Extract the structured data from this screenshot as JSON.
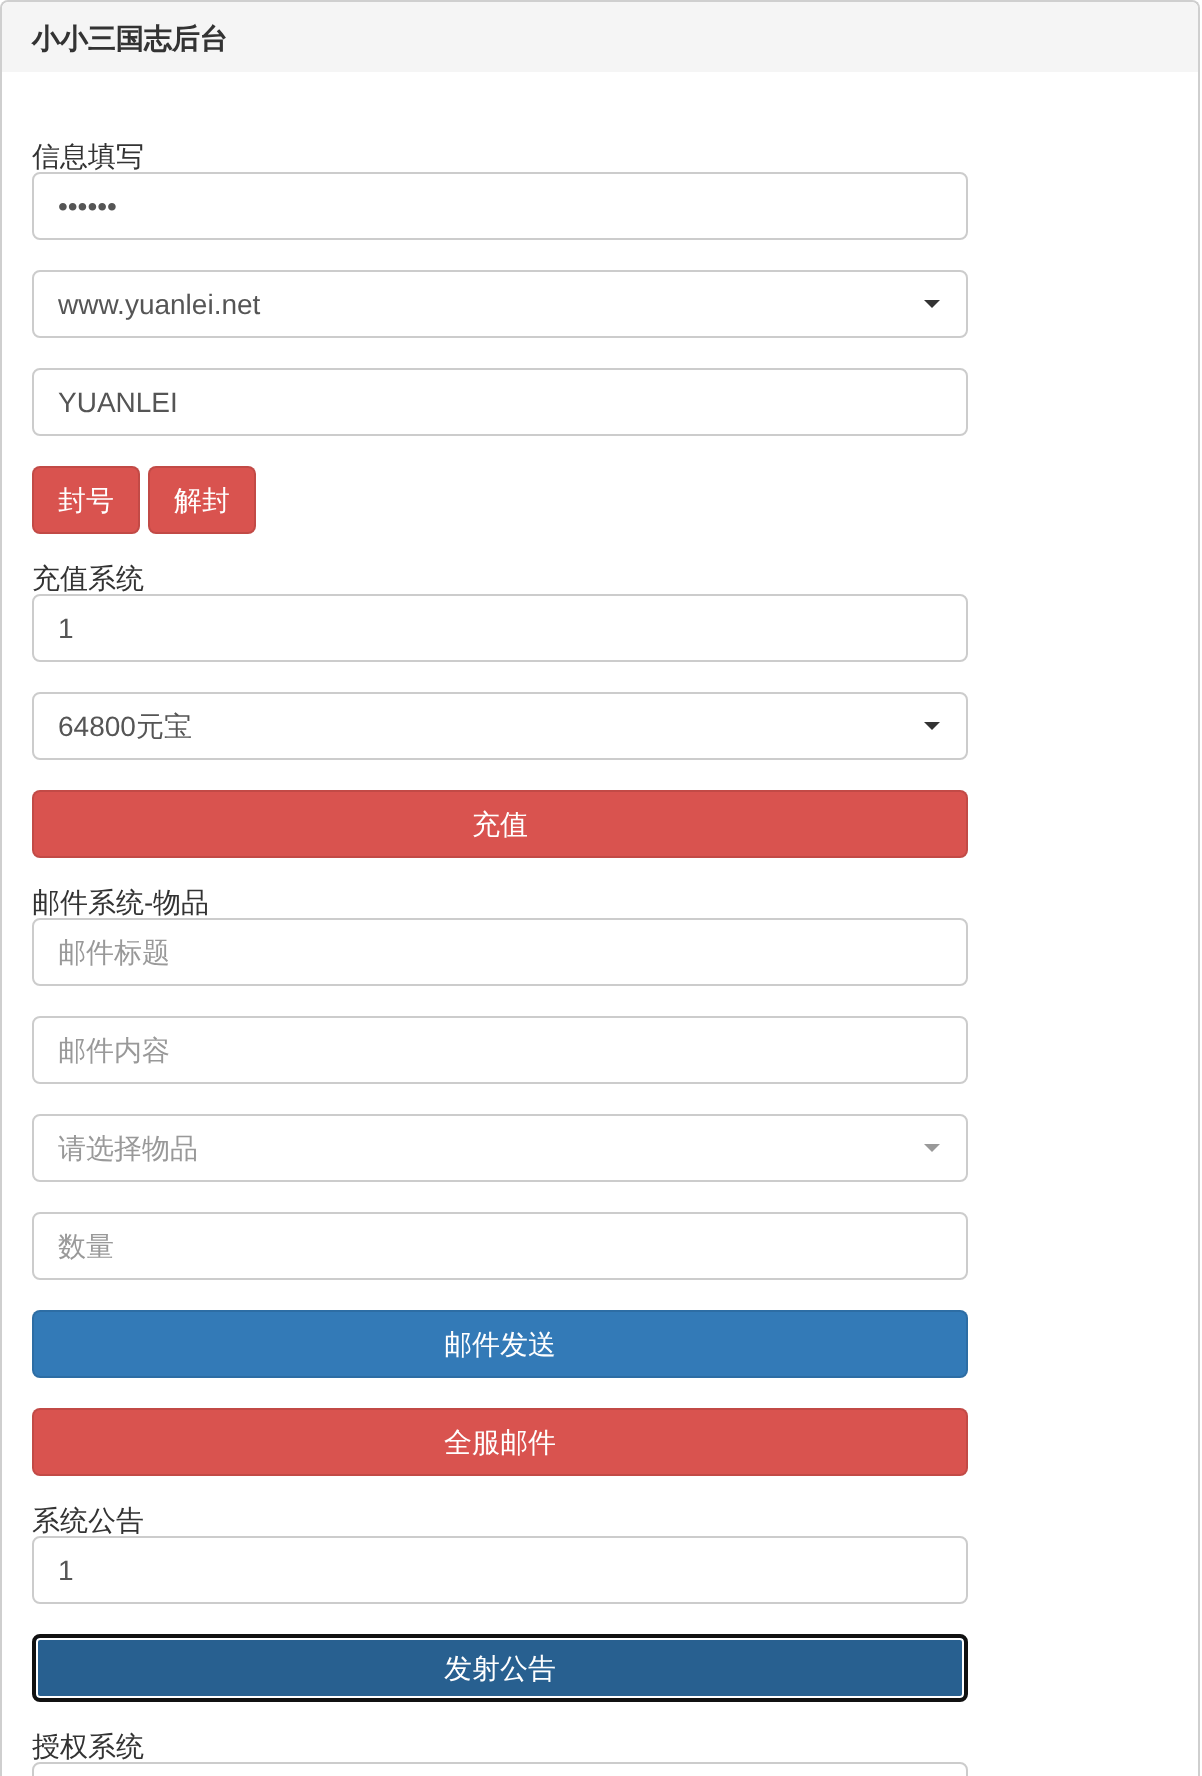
{
  "panel": {
    "title": "小小三国志后台"
  },
  "sections": [
    {
      "label": "信息填写",
      "controls": [
        {
          "kind": "password",
          "value": "••••••"
        },
        {
          "kind": "select",
          "value": "www.yuanlei.net"
        },
        {
          "kind": "text",
          "value": "YUANLEI"
        },
        {
          "kind": "buttons",
          "buttons": [
            {
              "label": "封号",
              "color": "#d9534f",
              "focused": false
            },
            {
              "label": "解封",
              "color": "#d9534f",
              "focused": false
            }
          ]
        }
      ]
    },
    {
      "label": "充值系统",
      "controls": [
        {
          "kind": "text",
          "value": "1"
        },
        {
          "kind": "select",
          "value": "64800元宝"
        },
        {
          "kind": "button",
          "label": "充值",
          "color": "#d9534f",
          "focused": false
        }
      ]
    },
    {
      "label": "邮件系统-物品",
      "controls": [
        {
          "kind": "text",
          "placeholder": "邮件标题"
        },
        {
          "kind": "text",
          "placeholder": "邮件内容"
        },
        {
          "kind": "select",
          "placeholder": "请选择物品"
        },
        {
          "kind": "text",
          "placeholder": "数量"
        },
        {
          "kind": "button",
          "label": "邮件发送",
          "color": "#337ab7",
          "focused": false
        },
        {
          "kind": "button",
          "label": "全服邮件",
          "color": "#d9534f",
          "focused": false
        }
      ]
    },
    {
      "label": "系统公告",
      "controls": [
        {
          "kind": "text",
          "value": "1"
        },
        {
          "kind": "button",
          "label": "发射公告",
          "color": "#286090",
          "focused": true
        }
      ]
    },
    {
      "label": "授权系统",
      "controls": [
        {
          "kind": "text"
        }
      ]
    }
  ]
}
